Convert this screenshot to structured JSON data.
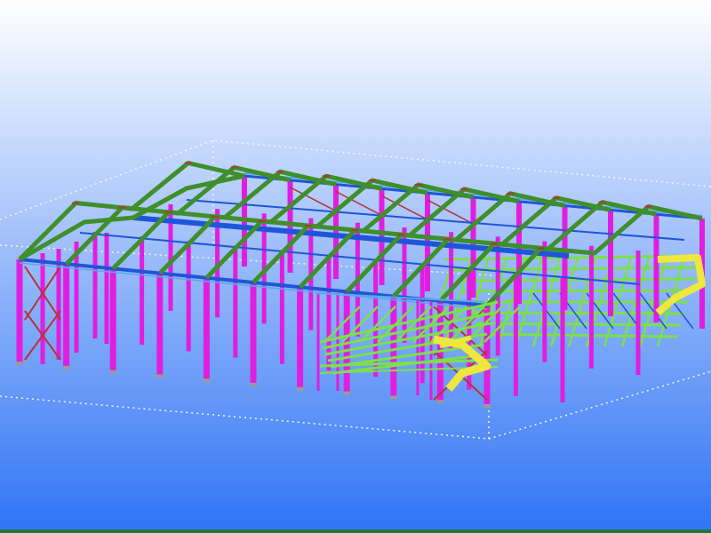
{
  "viewport": {
    "background_top": "#ffffff",
    "background_bottom": "#2f74f5",
    "bottom_strip_color": "#1c7a3a"
  },
  "model": {
    "colors": {
      "column": "#e01ee0",
      "rafter": "#3f8f2a",
      "eave_beam": "#1f55d8",
      "ridge_beam": "#1f55d8",
      "bracing": "#b8323a",
      "mezzanine": "#7be04a",
      "purlin": "#5aa8e8",
      "stair": "#f0e640",
      "base_plate": "#9a9a9a",
      "work_area_box": "#f4f4f4"
    },
    "frame_count": 11,
    "stairs": 2,
    "mezzanine_levels": 2
  }
}
